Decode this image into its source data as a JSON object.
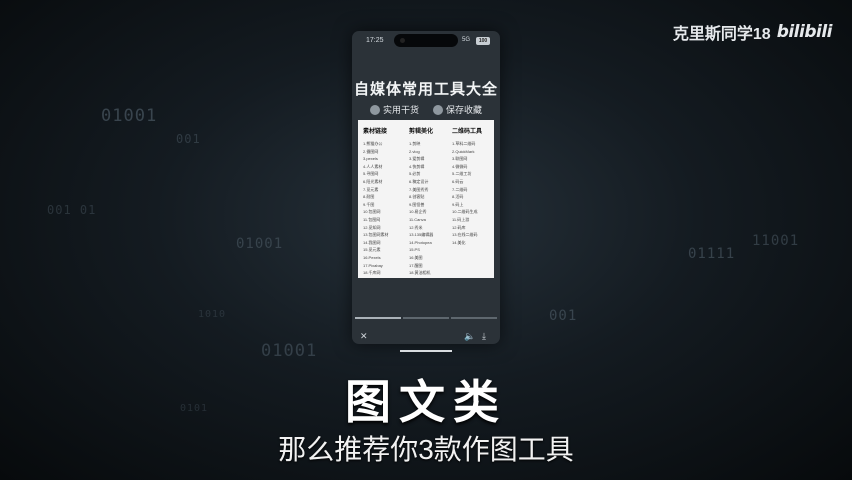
{
  "watermark": {
    "author": "克里斯同学18",
    "logo": "bilibili"
  },
  "background_bits": [
    "01001",
    "001",
    "001 01",
    "01001",
    "11001",
    "01111",
    "001",
    "01001",
    "0101",
    "1010"
  ],
  "phone": {
    "status": {
      "time": "17:25",
      "signal": "5G",
      "battery": "100"
    },
    "card_title": "自媒体常用工具大全",
    "tags": [
      {
        "icon": "thumbs-up-icon",
        "label": "实用干货"
      },
      {
        "icon": "star-icon",
        "label": "保存收藏"
      }
    ],
    "columns": [
      {
        "header": "素材链接",
        "items": [
          "1.熊猫办公",
          "2.摄图网",
          "3.pexels",
          "4.人人素材",
          "5.寻图网",
          "6.阳光素材",
          "7.觅元素",
          "8.耐图",
          "9.千图",
          "10.包图网",
          "11.包图网",
          "12.觅知网",
          "13.包图网素材",
          "14.我图网",
          "15.觅元素",
          "16.Pexels",
          "17.Pixabay",
          "18.千库网",
          "19.素材"
        ]
      },
      {
        "header": "剪辑美化",
        "items": [
          "1.剪映",
          "2.vlog",
          "3.爱剪辑",
          "4.快剪辑",
          "5.必剪",
          "6.稿定设计",
          "7.美图秀秀",
          "8.创客贴",
          "9.图怪兽",
          "10.易企秀",
          "11.Canva",
          "12.秀米",
          "13.135编辑器",
          "14.Photopea",
          "15.PS",
          "16.美图",
          "17.醒图",
          "18.黄油相机"
        ]
      },
      {
        "header": "二维码工具",
        "items": [
          "1.草料二维码",
          "2.QuickMark",
          "3.联图网",
          "4.微微码",
          "5.二维工坊",
          "6.码云",
          "7.二维码",
          "8.活码",
          "9.码上",
          "10.二维码生成",
          "11.码上游",
          "12.码库",
          "13.在线二维码",
          "14.美化"
        ]
      }
    ],
    "progress": {
      "segments": 3,
      "active": 1
    },
    "controls": {
      "close": "✕",
      "volume": "🔈",
      "download": "⤓"
    }
  },
  "caption": {
    "title": "图文类",
    "subtitle": "那么推荐你3款作图工具"
  }
}
